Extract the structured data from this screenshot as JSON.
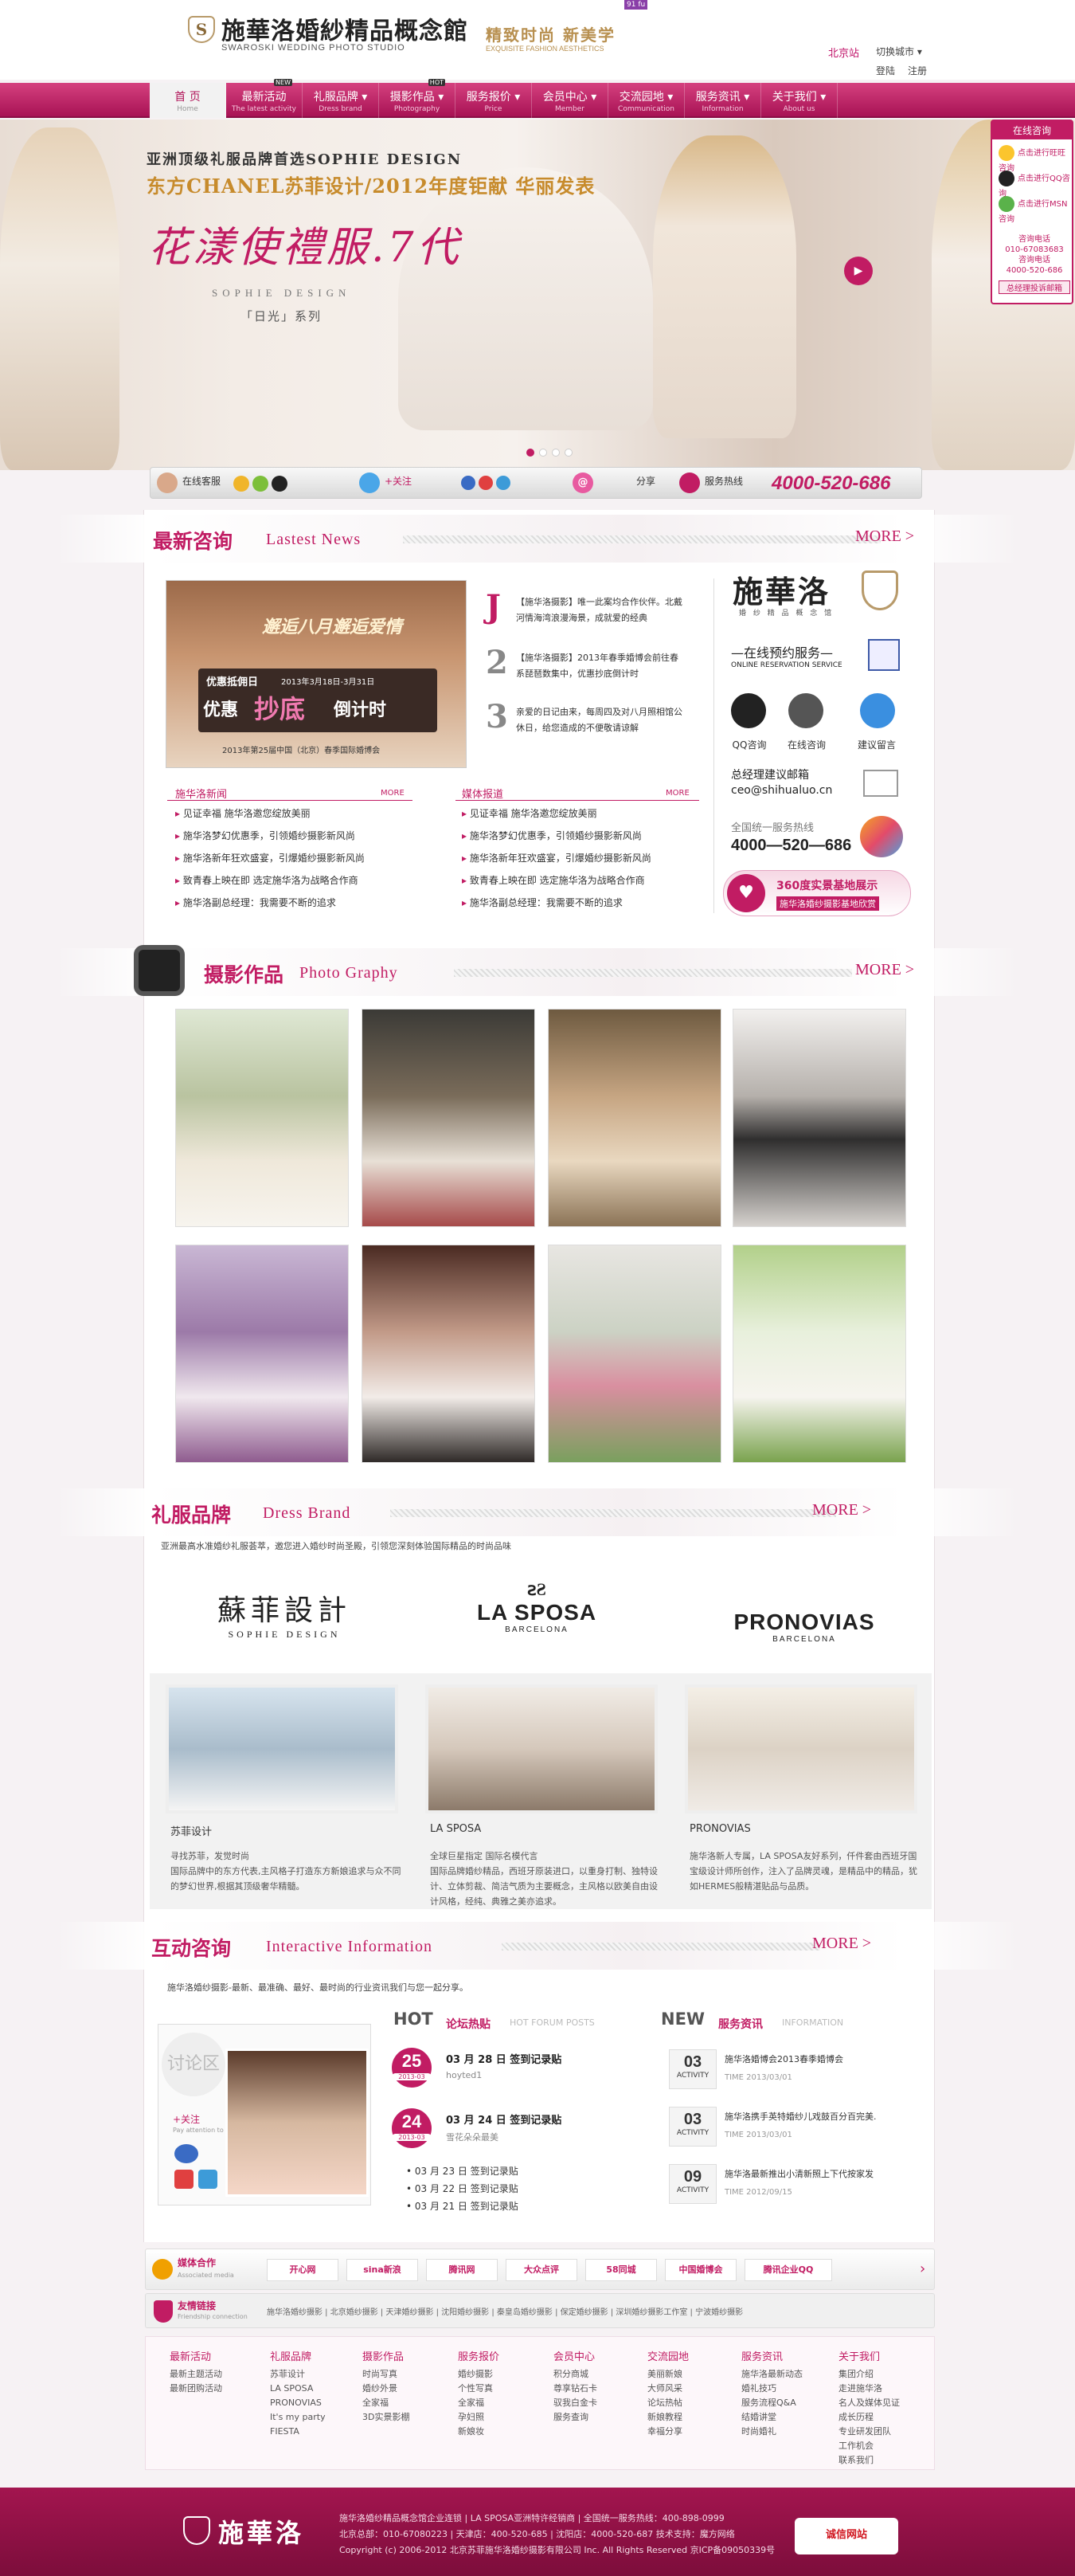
{
  "header": {
    "logo_mark": "S",
    "title": "施華洛婚紗精品概念館",
    "subtitle": "SWAROSKI WEDDING PHOTO STUDIO",
    "slogan": "精致时尚 新美学",
    "slogan_sub": "EXQUISITE FASHION AESTHETICS",
    "badge": "91 fu",
    "city": "北京站",
    "switch_city": "切换城市 ▾",
    "login": "登陆",
    "register": "注册"
  },
  "nav": [
    {
      "label": "首 页",
      "en": "Home"
    },
    {
      "label": "最新活动",
      "en": "The latest activity"
    },
    {
      "label": "礼服品牌 ▾",
      "en": "Dress brand"
    },
    {
      "label": "摄影作品 ▾",
      "en": "Photography"
    },
    {
      "label": "服务报价 ▾",
      "en": "Price"
    },
    {
      "label": "会员中心 ▾",
      "en": "Member"
    },
    {
      "label": "交流园地 ▾",
      "en": "Communication"
    },
    {
      "label": "服务资讯 ▾",
      "en": "Information"
    },
    {
      "label": "关于我们 ▾",
      "en": "About us"
    }
  ],
  "nav_hot": [
    "NEW",
    "HOT"
  ],
  "banner": {
    "brand_line": "亚洲顶级礼服品牌首选SOPHIE DESIGN",
    "headline": "东方CHANEL苏菲设计/2012年度钜献 华丽发表",
    "script": "花漾使禮服.7代",
    "sophie": "SOPHIE DESIGN",
    "series": "「日光」系列",
    "play": "▶"
  },
  "service_bar": {
    "online": "在线客服",
    "follow": "+关注",
    "share": "分享",
    "hotline_label": "服务热线",
    "hotline": "4000-520-686"
  },
  "side_panel": {
    "title": "在线咨询",
    "rows": [
      "点击进行旺旺咨询",
      "点击进行QQ咨询",
      "点击进行MSN咨询"
    ],
    "phone_label": "咨询电话",
    "phone1": "010-67083683",
    "phone2": "咨询电话",
    "phone3": "4000-520-686",
    "link": "总经理投诉邮箱"
  },
  "news": {
    "cn": "最新咨询",
    "en": "Lastest News",
    "more": "MORE >",
    "promo": {
      "line1": "邂逅八月邂逅爱情",
      "label": "优惠抵佣日",
      "date": "2013年3月18日-3月31日",
      "big1": "优惠",
      "big2": "抄底",
      "big3": "倒计时",
      "foot": "2013年第25届中国（北京）春季国际婚博会"
    },
    "feature": [
      {
        "num": "J",
        "text": "【施华洛摄影】唯一此案均合作伙伴。北戴河情海湾浪漫海景，成就爱的经典"
      },
      {
        "num": "2",
        "text": "【施华洛摄影】2013年春季婚博会前往春系琵琶数集中，优惠抄底倒计时"
      },
      {
        "num": "3",
        "text": "亲爱的日记由来，每周四及对八月照相馆公休日，给您造成的不便敬请谅解"
      }
    ],
    "list_left_title": "施华洛新闻",
    "list_right_title": "媒体报道",
    "list_more": "MORE",
    "list_left": [
      "见证幸福 施华洛邀您绽放美丽",
      "施华洛梦幻优惠季，引领婚纱摄影新风尚",
      "施华洛新年狂欢盛宴，引爆婚纱摄影新风尚",
      "致青春上映在即 选定施华洛为战略合作商",
      "施华洛副总经理：我需要不断的追求"
    ],
    "list_right": [
      "见证幸福 施华洛邀您绽放美丽",
      "施华洛梦幻优惠季，引领婚纱摄影新风尚",
      "施华洛新年狂欢盛宴，引爆婚纱摄影新风尚",
      "致青春上映在即 选定施华洛为战略合作商",
      "施华洛副总经理：我需要不断的追求"
    ],
    "right": {
      "logo": "施華洛",
      "logo_sub": "婚 纱 精 品 概 念 馆",
      "reserve": "—在线预约服务—",
      "reserve_en": "ONLINE RESERVATION SERVICE",
      "icons": [
        "QQ咨询",
        "在线咨询",
        "建议留言"
      ],
      "gm": "总经理建议邮箱",
      "email": "ceo@shihualuo.cn",
      "hotline_label": "全国统一服务热线",
      "hotline": "4000—520—686",
      "vr1": "360度实景基地展示",
      "vr2": "施华洛婚纱摄影基地欣赏"
    }
  },
  "photo": {
    "cn": "摄影作品",
    "en": "Photo Graphy",
    "more": "MORE >"
  },
  "brand": {
    "cn": "礼服品牌",
    "en": "Dress Brand",
    "more": "MORE >",
    "desc": "亚洲最高水准婚纱礼服荟萃，邀您进入婚纱时尚圣殿，引领您深刻体验国际精品的时尚品味",
    "logos": [
      "蘇菲設計",
      "SOPHIE DESIGN",
      "LA SPOSA",
      "BARCELONA",
      "PRONOVIAS",
      "BARCELONA"
    ],
    "items": [
      {
        "name": "苏菲设计",
        "desc": "寻找苏菲，发觉时尚\n国际品牌中的东方代表,主风格子打造东方新娘追求与众不同的梦幻世界,根据其顶级奢华精髓。"
      },
      {
        "name": "LA SPOSA",
        "desc": "全球巨星指定 国际名模代言\n国际品牌婚纱精品，西班牙原装进口，以重身打制、独特设计、立体剪裁、简洁气质为主要概念，主风格以欧美自由设计风格，经纯、典雅之美亦追求。"
      },
      {
        "name": "PRONOVIAS",
        "desc": "施华洛新人专属，LA SPOSA友好系列，仟件套由西班牙国宝级设计师所创作，注入了品牌灵魂，是精品中的精品，犹如HERMES般精湛贴品与品质。"
      }
    ]
  },
  "inter": {
    "cn": "互动咨询",
    "en": "Interactive Information",
    "more": "MORE >",
    "desc": "施华洛婚纱摄影-最新、最准确、最好、最时尚的行业资讯我们与您一起分享。",
    "discuss": "讨论区",
    "follow": "+关注",
    "follow_sub": "Pay attention to",
    "hot": "HOT",
    "hot_cn": "论坛热贴",
    "hot_en": "HOT FORUM POSTS",
    "posts": [
      {
        "day": "25",
        "ym": "2013-03",
        "title": "03 月 28 日 签到记录贴",
        "user": "hoyted1"
      },
      {
        "day": "24",
        "ym": "2013-03",
        "title": "03 月 24 日 签到记录贴",
        "user": "雪花朵朵最美"
      }
    ],
    "post_links": [
      "03 月 23 日 签到记录贴",
      "03 月 22 日 签到记录贴",
      "03 月 21 日 签到记录贴"
    ],
    "new": "NEW",
    "new_cn": "服务资讯",
    "new_en": "INFORMATION",
    "acts": [
      {
        "day": "03",
        "label": "ACTIVITY",
        "title": "施华洛婚博会2013春季婚博会",
        "time": "TIME 2013/03/01"
      },
      {
        "day": "03",
        "label": "ACTIVITY",
        "title": "施华洛携手英特婚纱儿戏鼓百分百完美.",
        "time": "TIME 2013/03/01"
      },
      {
        "day": "09",
        "label": "ACTIVITY",
        "title": "施华洛最新推出小清新照上下代按家发",
        "time": "TIME 2012/09/15"
      }
    ]
  },
  "partner": {
    "label": "媒体合作",
    "label_en": "Associated media",
    "logos": [
      "开心网",
      "sina新浪",
      "腾讯网",
      "大众点评",
      "58同城",
      "中国婚博会",
      "腾讯企业QQ"
    ],
    "friend": "友情链接",
    "friend_en": "Friendship connection",
    "links": "施华洛婚纱摄影 | 北京婚纱摄影 | 天津婚纱摄影 | 沈阳婚纱摄影 | 秦皇岛婚纱摄影 | 保定婚纱摄影 | 深圳婚纱摄影工作室 | 宁波婚纱摄影"
  },
  "sitemap": [
    {
      "title": "最新活动",
      "items": [
        "最新主题活动",
        "最新团购活动"
      ]
    },
    {
      "title": "礼服品牌",
      "items": [
        "苏菲设计",
        "LA SPOSA",
        "PRONOVIAS",
        "It's my party",
        "FIESTA"
      ]
    },
    {
      "title": "摄影作品",
      "items": [
        "时尚写真",
        "婚纱外景",
        "全家福",
        "3D实景影棚"
      ]
    },
    {
      "title": "服务报价",
      "items": [
        "婚纱摄影",
        "个性写真",
        "全家福",
        "孕妇照",
        "新娘妆"
      ]
    },
    {
      "title": "会员中心",
      "items": [
        "积分商城",
        "尊享钻石卡",
        "驭我白金卡",
        "服务查询"
      ]
    },
    {
      "title": "交流园地",
      "items": [
        "美丽新娘",
        "大师风采",
        "论坛热帖",
        "新娘教程",
        "幸福分享"
      ]
    },
    {
      "title": "服务资讯",
      "items": [
        "施华洛最新动态",
        "婚礼技巧",
        "服务流程Q&A",
        "结婚讲堂",
        "时尚婚礼"
      ]
    },
    {
      "title": "关于我们",
      "items": [
        "集团介绍",
        "走进施华洛",
        "名人及媒体见证",
        "成长历程",
        "专业研发团队",
        "工作机会",
        "联系我们"
      ]
    }
  ],
  "footer": {
    "logo": "施華洛",
    "line1": "施华洛婚纱精品概念馆企业连锁 | LA SPOSA亚洲特许经销商 | 全国统一服务热线：400-898-0999",
    "line2": "北京总部：010-67080223 | 天津店：400-520-685 | 沈阳店：4000-520-687  技术支持：魔方网络",
    "line3": "Copyright (c) 2006-2012 北京苏菲施华洛婚纱摄影有限公司 Inc. All Rights Reserved  京ICP备09050339号",
    "badge": "诚信网站"
  }
}
